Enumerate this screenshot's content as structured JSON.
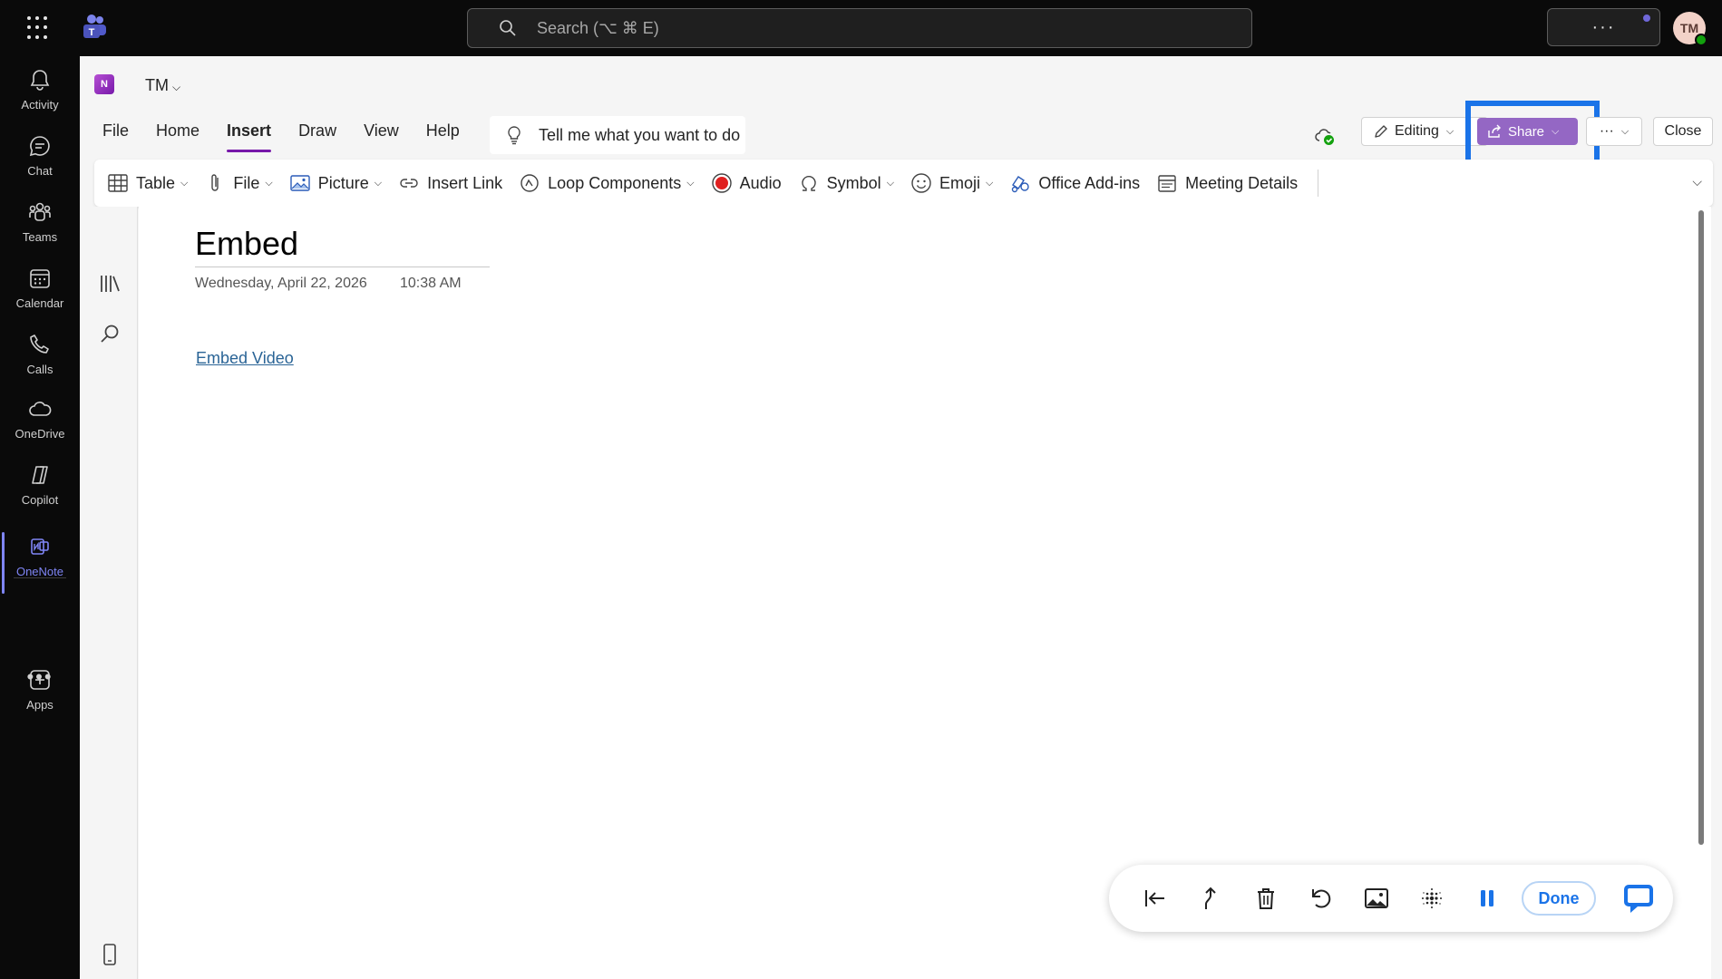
{
  "topbar": {
    "search_placeholder": "Search (⌥ ⌘ E)",
    "more_label": "···",
    "avatar_initials": "TM"
  },
  "rail": {
    "items": [
      {
        "label": "Activity",
        "icon": "bell-icon"
      },
      {
        "label": "Chat",
        "icon": "chat-icon"
      },
      {
        "label": "Teams",
        "icon": "teams-icon"
      },
      {
        "label": "Calendar",
        "icon": "calendar-icon"
      },
      {
        "label": "Calls",
        "icon": "phone-icon"
      },
      {
        "label": "OneDrive",
        "icon": "cloud-icon"
      },
      {
        "label": "Copilot",
        "icon": "copilot-icon"
      },
      {
        "label": "OneNote",
        "icon": "onenote-icon"
      },
      {
        "label": "Apps",
        "icon": "plus-box-icon"
      }
    ],
    "more_label": "•••"
  },
  "notebook": {
    "icon_letter": "N",
    "title": "TM"
  },
  "menu": {
    "tabs": [
      "File",
      "Home",
      "Insert",
      "Draw",
      "View",
      "Help"
    ],
    "active": "Insert",
    "tellme": "Tell me what you want to do"
  },
  "actions": {
    "editing": "Editing",
    "share": "Share",
    "overflow": "···",
    "close": "Close"
  },
  "ribbon": {
    "items": [
      {
        "label": "Table",
        "icon": "table-icon",
        "dropdown": true
      },
      {
        "label": "File",
        "icon": "paperclip-icon",
        "dropdown": true
      },
      {
        "label": "Picture",
        "icon": "picture-icon",
        "dropdown": true
      },
      {
        "label": "Insert Link",
        "icon": "link-icon",
        "dropdown": false
      },
      {
        "label": "Loop Components",
        "icon": "loop-icon",
        "dropdown": true
      },
      {
        "label": "Audio",
        "icon": "record-icon",
        "dropdown": false
      },
      {
        "label": "Symbol",
        "icon": "omega-icon",
        "dropdown": true
      },
      {
        "label": "Emoji",
        "icon": "emoji-icon",
        "dropdown": true
      },
      {
        "label": "Office Add-ins",
        "icon": "addins-icon",
        "dropdown": false
      },
      {
        "label": "Meeting Details",
        "icon": "meeting-icon",
        "dropdown": false
      }
    ]
  },
  "page": {
    "title": "Embed",
    "date": "Wednesday, April 22, 2026",
    "time": "10:38 AM",
    "link": "Embed Video"
  },
  "floatbar": {
    "done": "Done"
  },
  "colors": {
    "accent_purple": "#7719aa",
    "share_bg": "#9467c4",
    "highlight_blue": "#1a73e8",
    "rail_active": "#7f85f5"
  }
}
